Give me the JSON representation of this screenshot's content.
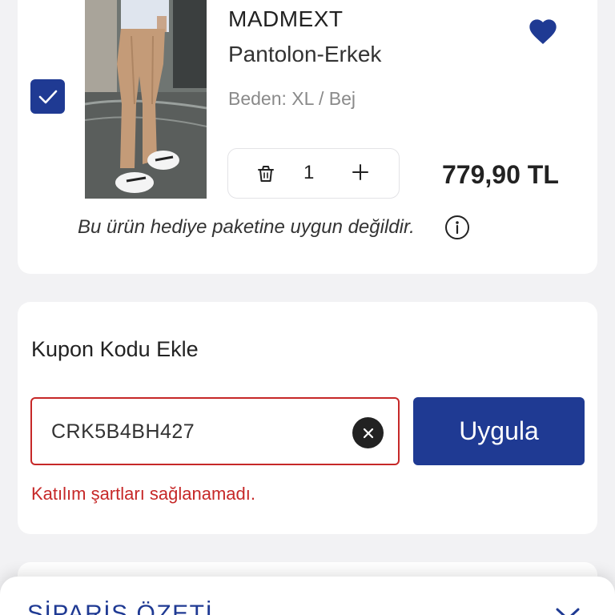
{
  "product": {
    "brand": "MADMEXT",
    "name": "Pantolon-Erkek",
    "variant": "Beden: XL /  Bej",
    "quantity": "1",
    "price": "779,90 TL",
    "gift_note": "Bu ürün hediye paketine uygun değildir.",
    "selected": true,
    "favorited": true
  },
  "coupon": {
    "title": "Kupon Kodu Ekle",
    "value": "CRK5B4BH427",
    "apply_label": "Uygula",
    "error": "Katılım şartları sağlanamadı."
  },
  "summary": {
    "title": "SİPARİŞ ÖZETİ"
  },
  "icons": {
    "checkbox": "check-icon",
    "favorite": "heart-icon",
    "trash": "trash-icon",
    "plus": "plus-icon",
    "info": "info-icon",
    "clear": "close-icon",
    "chevron": "chevron-down-icon"
  },
  "colors": {
    "brand_blue": "#1f3a93",
    "error_red": "#c62828",
    "background": "#f2f2f4"
  }
}
